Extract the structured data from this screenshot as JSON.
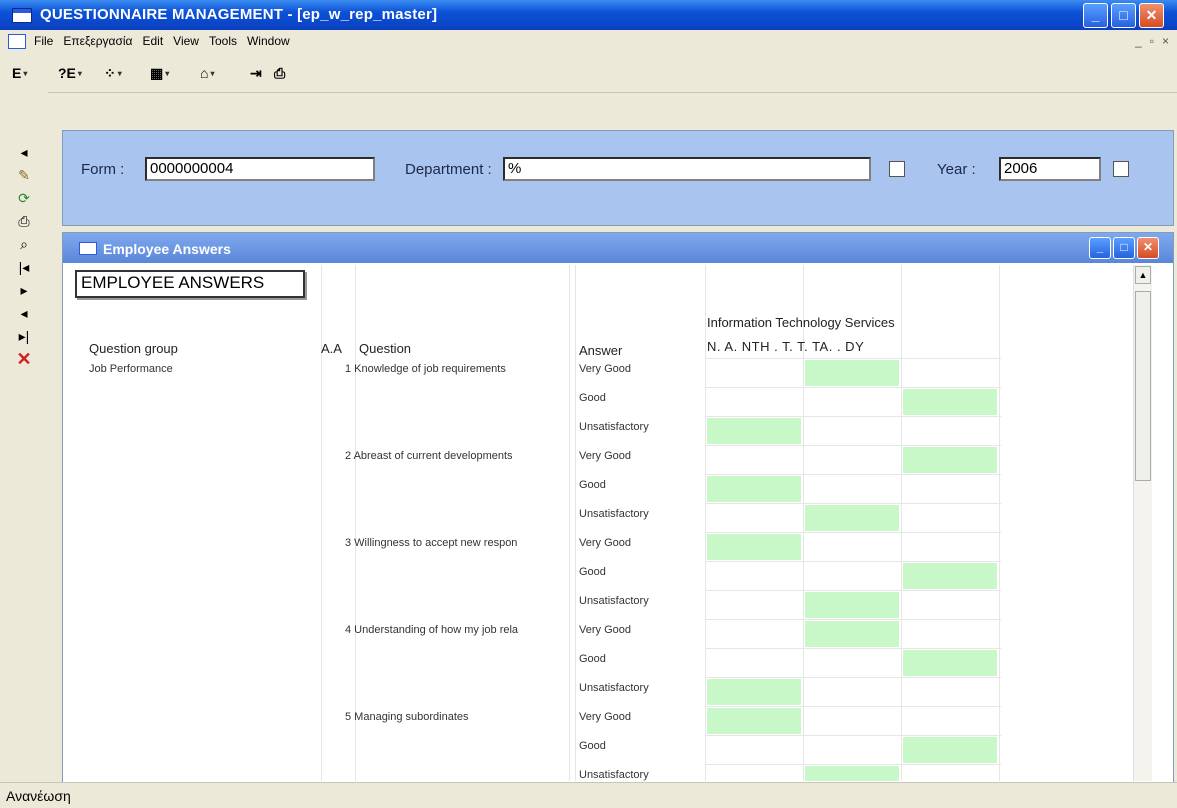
{
  "window": {
    "title": "QUESTIONNAIRE MANAGEMENT - [ep_w_rep_master]"
  },
  "menu": {
    "items": [
      "File",
      "Επεξεργασία",
      "Edit",
      "View",
      "Tools",
      "Window"
    ],
    "mdi_controls": [
      "_",
      "▫",
      "×"
    ]
  },
  "toolbar": {
    "buttons": [
      {
        "name": "export-e-icon",
        "glyph": "E"
      },
      {
        "name": "help-e-icon",
        "glyph": "?E"
      },
      {
        "name": "color-dots-icon",
        "glyph": "⁘"
      },
      {
        "name": "grid-icon",
        "glyph": "▦"
      },
      {
        "name": "building-icon",
        "glyph": "⌂"
      },
      {
        "name": "exit-door-icon",
        "glyph": "⇥"
      },
      {
        "name": "printer-icon",
        "glyph": "⎙"
      }
    ]
  },
  "left_tools": [
    {
      "name": "back-arrow-icon",
      "glyph": "◂"
    },
    {
      "name": "retrieve-icon",
      "glyph": "✎"
    },
    {
      "name": "refresh-icon",
      "glyph": "⟳"
    },
    {
      "name": "print-icon",
      "glyph": "⎙"
    },
    {
      "name": "preview-icon",
      "glyph": "⌕"
    },
    {
      "name": "first-record-icon",
      "glyph": "|◂"
    },
    {
      "name": "next-record-icon",
      "glyph": "▸"
    },
    {
      "name": "previous-record-icon",
      "glyph": "◂"
    },
    {
      "name": "last-record-icon",
      "glyph": "▸|"
    },
    {
      "name": "delete-icon",
      "glyph": "✕"
    }
  ],
  "form": {
    "form_label": "Form :",
    "form_value": "0000000004",
    "department_label": "Department :",
    "department_value": "%",
    "year_label": "Year :",
    "year_value": "2006"
  },
  "child_window": {
    "title": "Employee Answers"
  },
  "report": {
    "title": "EMPLOYEE ANSWERS",
    "department_heading": "Information Technology Services",
    "employees_header": "N. A. NTH   . T. T. TA.  . DY",
    "columns": {
      "group": "Question group",
      "aa": "A.A",
      "question": "Question",
      "answer": "Answer"
    },
    "group_name": "Job Performance",
    "questions": [
      {
        "num": "1",
        "text": "Knowledge of job requirements"
      },
      {
        "num": "2",
        "text": "Abreast of current developments"
      },
      {
        "num": "3",
        "text": "Willingness to accept new respon"
      },
      {
        "num": "4",
        "text": "Understanding of how my job rela"
      },
      {
        "num": "5",
        "text": "Managing subordinates"
      }
    ],
    "answers": [
      "Very Good",
      "Good",
      "Unsatisfactory"
    ],
    "marks": [
      [
        2,
        0,
        1
      ],
      [
        1,
        2,
        0
      ],
      [
        0,
        2,
        1
      ],
      [
        2,
        0,
        1
      ],
      [
        0,
        2,
        1
      ]
    ],
    "mark_color": "#c8f7c8"
  },
  "status": {
    "text": "Ανανέωση"
  }
}
